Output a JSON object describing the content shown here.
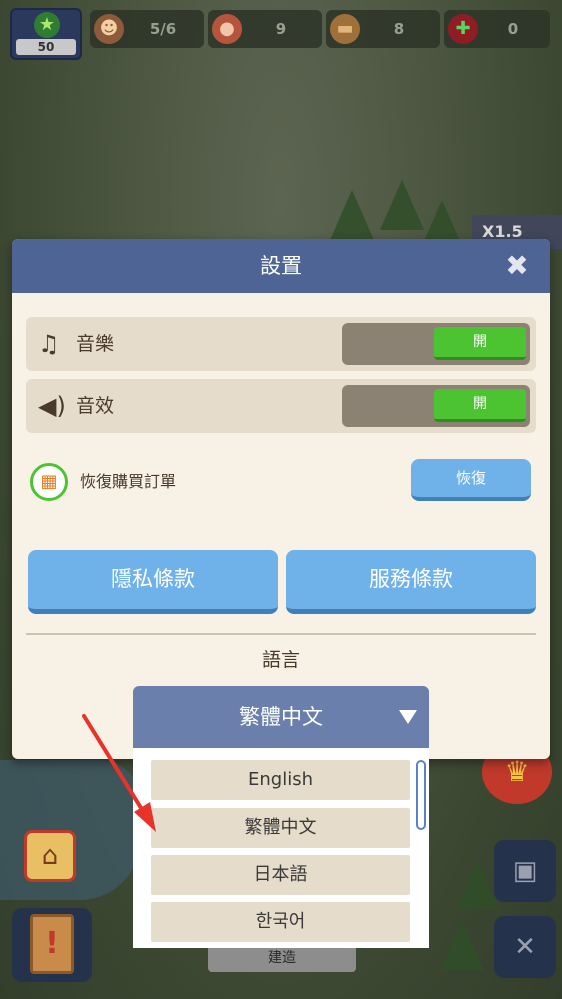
{
  "topbar": {
    "level": "50",
    "workers": "5/6",
    "meat": "9",
    "wood": "8",
    "gems": "0"
  },
  "side": {
    "speed": "X1.5",
    "build_label": "建造"
  },
  "dialog": {
    "title": "設置",
    "music_label": "音樂",
    "music_state": "開",
    "sfx_label": "音效",
    "sfx_state": "開",
    "restore_label": "恢復購買訂單",
    "restore_button": "恢復",
    "privacy_button": "隱私條款",
    "terms_button": "服務條款",
    "language_heading": "語言"
  },
  "language": {
    "selected": "繁體中文",
    "options": [
      "English",
      "繁體中文",
      "日本語",
      "한국어"
    ]
  },
  "colors": {
    "header": "#4d6495",
    "toggle_on": "#4cc431",
    "button_blue": "#6fb2ea",
    "annotation_arrow": "#e8332a"
  }
}
